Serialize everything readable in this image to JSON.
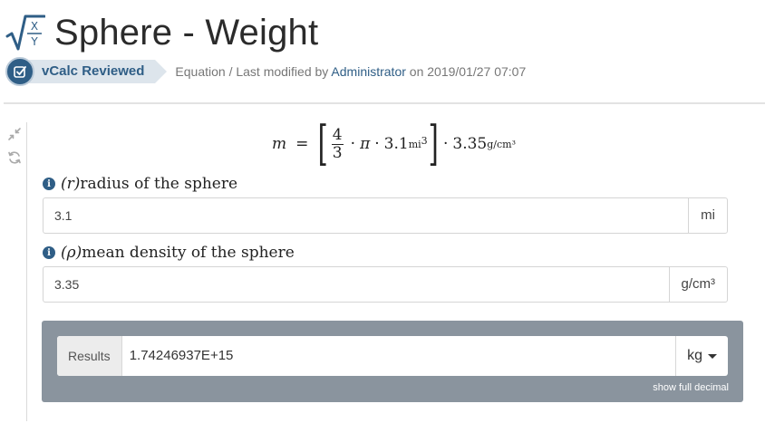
{
  "page": {
    "title": "Sphere - Weight"
  },
  "meta": {
    "badge_label": "vCalc Reviewed",
    "prefix": "Equation / Last modified by",
    "author": "Administrator",
    "on_text": "on",
    "modified": "2019/01/27 07:07"
  },
  "icons": {
    "logo": "sqrt-fraction-logo-icon",
    "badge": "check-square-icon",
    "collapse": "collapse-arrows-icon",
    "refresh": "refresh-icon",
    "info": "info-icon",
    "dropdown": "caret-down-icon"
  },
  "formula": {
    "lhs": "m",
    "eq": "=",
    "frac_num": "4",
    "frac_den": "3",
    "dot": "·",
    "pi": "π",
    "radius_value": "3.1",
    "radius_unit": "mi",
    "exponent": "3",
    "density_value": "3.35",
    "density_unit": "g/cm³"
  },
  "fields": [
    {
      "symbol": "(r)",
      "label": "radius of the sphere",
      "value": "3.1",
      "unit": "mi"
    },
    {
      "symbol": "(ρ)",
      "label": "mean density of the sphere",
      "value": "3.35",
      "unit": "g/cm³"
    }
  ],
  "results": {
    "label": "Results",
    "value": "1.74246937E+15",
    "unit": "kg",
    "show_full_decimal": "show full decimal"
  },
  "colors": {
    "brand": "#2f5e86",
    "results_panel": "#8a949e"
  }
}
